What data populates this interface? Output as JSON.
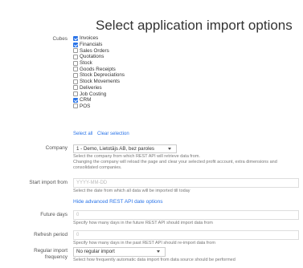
{
  "page_title": "Select application import options",
  "cubes": {
    "label": "Cubes",
    "items": [
      {
        "label": "Invoices",
        "checked": true
      },
      {
        "label": "Financials",
        "checked": true
      },
      {
        "label": "Sales Orders",
        "checked": false
      },
      {
        "label": "Quotations",
        "checked": false
      },
      {
        "label": "Stock",
        "checked": false
      },
      {
        "label": "Goods Receipts",
        "checked": false
      },
      {
        "label": "Stock Depreciations",
        "checked": false
      },
      {
        "label": "Stock Movements",
        "checked": false
      },
      {
        "label": "Deliveries",
        "checked": false
      },
      {
        "label": "Job Costing",
        "checked": false
      },
      {
        "label": "CRM",
        "checked": true
      },
      {
        "label": "POS",
        "checked": false
      }
    ],
    "select_all": "Select all",
    "clear_selection": "Clear selection"
  },
  "company": {
    "label": "Company",
    "value": "1 - Demo, Lietotājs AB, bez paroles",
    "help1": "Select the company from which REST API will retrieve data from.",
    "help2": "Changing the company will reload the page and clear your selected profit account, extra dimensions and consolidated companies."
  },
  "start_import": {
    "label": "Start import from",
    "placeholder": "YYYY-MM-DD",
    "help": "Select the date from which all data will be imported till today"
  },
  "advanced_link": "Hide advanced REST API date options",
  "future_days": {
    "label": "Future days",
    "value": "0",
    "help": "Specify how many days in the future REST API should import data from"
  },
  "refresh_period": {
    "label": "Refresh period",
    "value": "0",
    "help": "Specify how many days in the past REST API should re-import data from"
  },
  "regular_import": {
    "label_line1": "Regular import",
    "label_line2": "frequency",
    "value": "No regular import",
    "help": "Select how frequently automatic data import from data source should be performed"
  }
}
